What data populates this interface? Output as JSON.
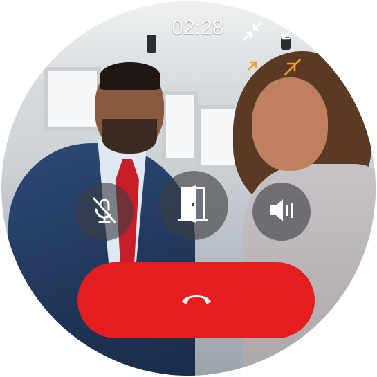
{
  "call": {
    "timer": "02:28",
    "status": "in-call"
  },
  "icons": {
    "minimize": "minimize-icon",
    "collapse": "collapse-icon",
    "expand": "expand-icon",
    "mute": "microphone-off-icon",
    "door": "door-open-icon",
    "speaker": "speaker-icon",
    "hangup": "phone-hangup-icon"
  },
  "colors": {
    "end_call": "#e41e1f",
    "control_bg": "#3c3e42",
    "accent_orange": "#f0a020",
    "text": "#ffffff"
  }
}
